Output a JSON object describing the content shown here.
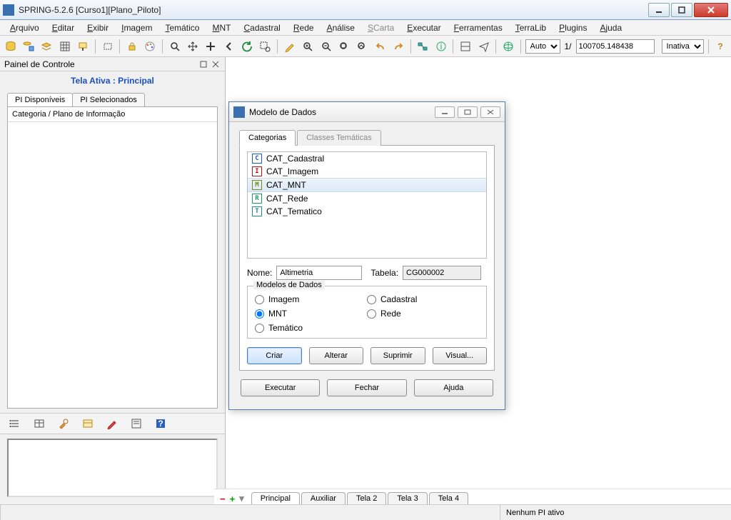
{
  "window": {
    "title": "SPRING-5.2.6 [Curso1][Plano_Piloto]"
  },
  "menus": [
    "Arquivo",
    "Editar",
    "Exibir",
    "Imagem",
    "Temático",
    "MNT",
    "Cadastral",
    "Rede",
    "Análise",
    "SCarta",
    "Executar",
    "Ferramentas",
    "TerraLib",
    "Plugins",
    "Ajuda"
  ],
  "menu_disabled": [
    "SCarta"
  ],
  "toolbar": {
    "scale_mode": "Auto",
    "scale_sep": "1/",
    "scale_value": "100705.148438",
    "status_mode": "Inativa"
  },
  "panel": {
    "title": "Painel de Controle",
    "tela_ativa": "Tela Ativa : Principal",
    "tabs": [
      "PI Disponíveis",
      "PI Selecionados"
    ],
    "active_tab": 0,
    "list_header": "Categoria / Plano de Informação"
  },
  "bottom_tabs": [
    "Principal",
    "Auxiliar",
    "Tela 2",
    "Tela 3",
    "Tela 4"
  ],
  "status": {
    "right": "Nenhum PI ativo"
  },
  "dialog": {
    "title": "Modelo de Dados",
    "tabs": [
      "Categorias",
      "Classes Temáticas"
    ],
    "active_tab": 0,
    "categories": [
      {
        "code": "C",
        "color": "#1560c0",
        "label": "CAT_Cadastral"
      },
      {
        "code": "I",
        "color": "#c01515",
        "label": "CAT_Imagem"
      },
      {
        "code": "M",
        "color": "#6b8f1a",
        "label": "CAT_MNT",
        "selected": true
      },
      {
        "code": "R",
        "color": "#1a9f6b",
        "label": "CAT_Rede"
      },
      {
        "code": "T",
        "color": "#1a8f8f",
        "label": "CAT_Tematico"
      }
    ],
    "nome_label": "Nome:",
    "nome_value": "Altimetria",
    "tabela_label": "Tabela:",
    "tabela_value": "CG000002",
    "group_label": "Modelos de Dados",
    "radios": [
      "Imagem",
      "Cadastral",
      "MNT",
      "Rede",
      "Temático"
    ],
    "radio_selected": "MNT",
    "inner_buttons": [
      "Criar",
      "Alterar",
      "Suprimir",
      "Visual..."
    ],
    "outer_buttons": [
      "Executar",
      "Fechar",
      "Ajuda"
    ]
  }
}
